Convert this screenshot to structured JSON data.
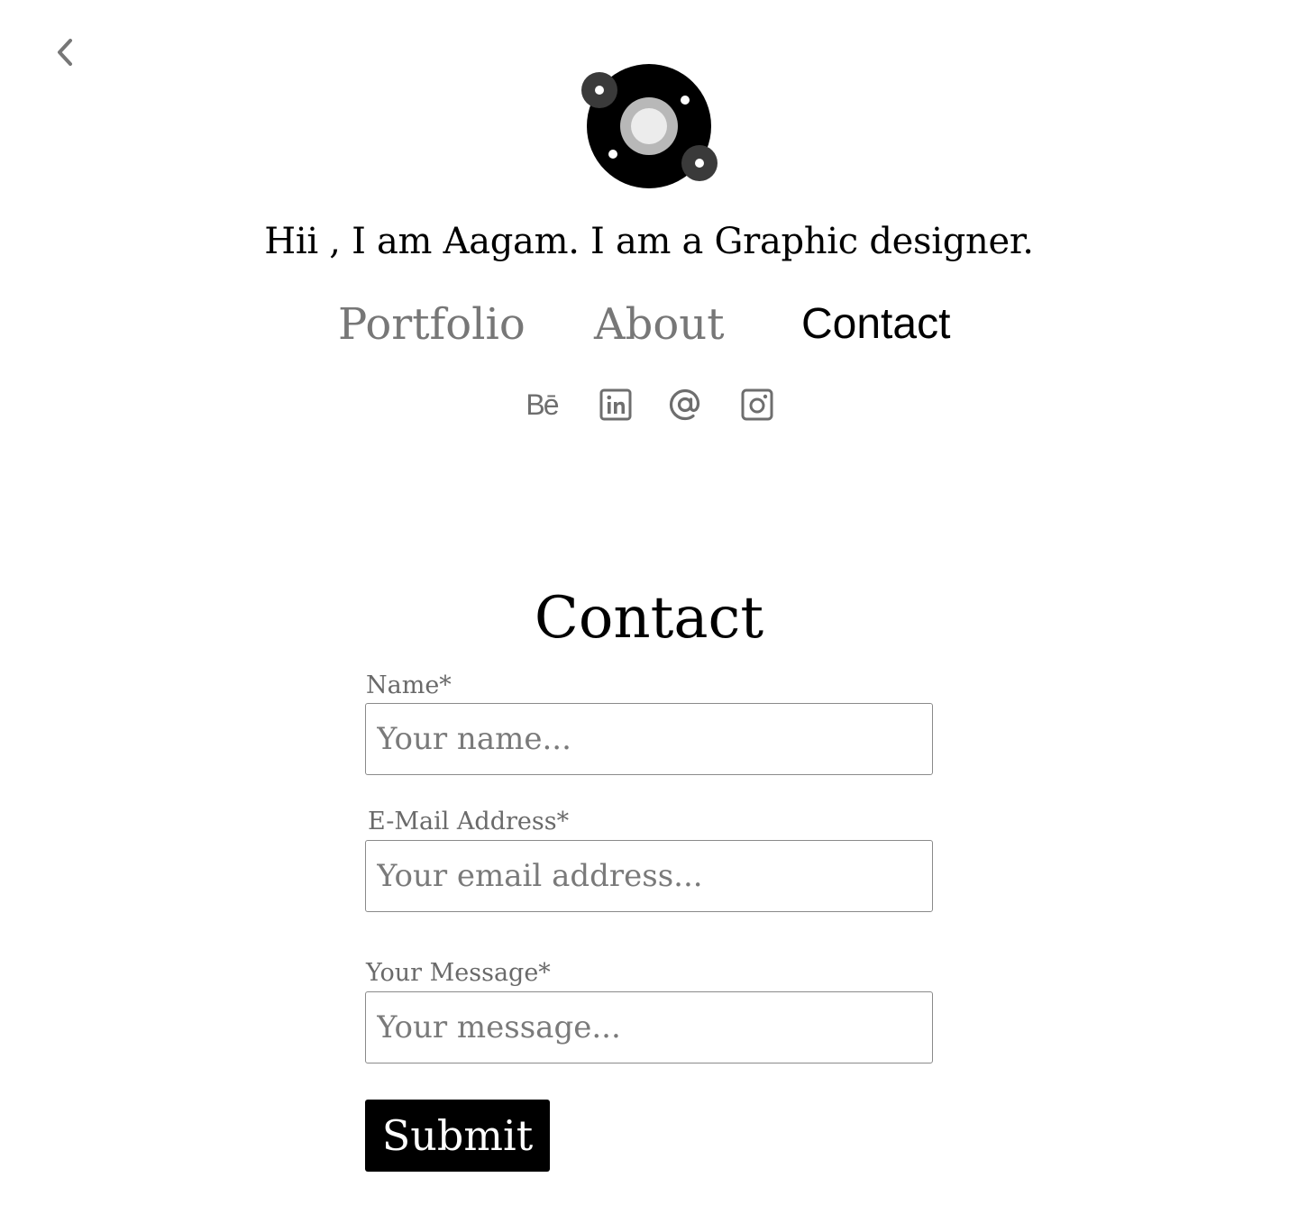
{
  "header": {
    "back_icon": "chevron-left-icon",
    "logo_icon": "planet-logo-icon",
    "tagline": "Hii , I am Aagam. I am a Graphic designer."
  },
  "nav": {
    "items": [
      {
        "label": "Portfolio",
        "active": false
      },
      {
        "label": "About",
        "active": false
      },
      {
        "label": "Contact",
        "active": true
      }
    ]
  },
  "social": {
    "behance_label": "Bē",
    "icons": [
      "behance-icon",
      "linkedin-icon",
      "email-at-icon",
      "instagram-icon"
    ]
  },
  "contact_form": {
    "title": "Contact",
    "name_label": "Name*",
    "name_placeholder": "Your name...",
    "email_label": "E-Mail Address*",
    "email_placeholder": "Your email address...",
    "message_label": "Your Message*",
    "message_placeholder": "Your message...",
    "submit_label": "Submit"
  },
  "colors": {
    "text": "#000000",
    "muted": "#777777",
    "icon": "#6e6e6e",
    "button_bg": "#000000",
    "button_text": "#ffffff"
  }
}
